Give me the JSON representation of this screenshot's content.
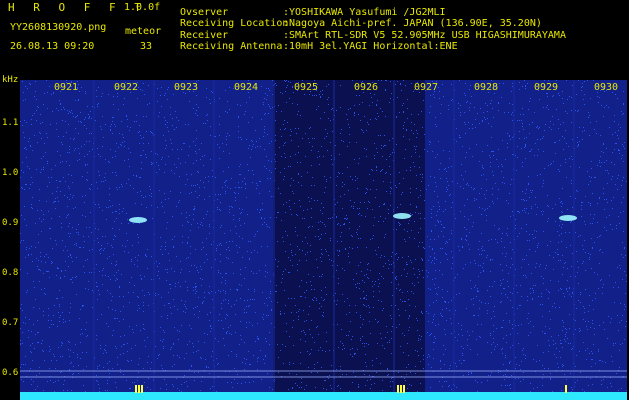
{
  "header": {
    "app_title": "H R O F F T",
    "version": "1.0.0f",
    "filename": "YY2608130920.png",
    "meteor_label": "meteor",
    "datetime": "26.08.13 09:20",
    "meteor_count": "33"
  },
  "station": [
    {
      "key": "Ovserver",
      "value": ":YOSHIKAWA Yasufumi /JG2MLI"
    },
    {
      "key": "Receiving Location",
      "value": ":Nagoya Aichi-pref. JAPAN (136.90E, 35.20N)"
    },
    {
      "key": "Receiver",
      "value": ":SMArt RTL-SDR V5 52.905MHz USB HIGASHIMURAYAMA"
    },
    {
      "key": "Receiving Antenna",
      "value": ":10mH 3el.YAGI Horizontal:ENE"
    }
  ],
  "spectrogram": {
    "y_unit": "kHz",
    "y_ticks": [
      "1.1",
      "1.0",
      "0.9",
      "0.8",
      "0.7",
      "0.6"
    ],
    "time_labels": [
      "0921",
      "0922",
      "0923",
      "0924",
      "0925",
      "0926",
      "0927",
      "0928",
      "0929",
      "0930"
    ],
    "colors": {
      "background": "#12208a",
      "dark_band": "#0a1050",
      "noise": "#2f5cff",
      "echo": "#9cf7ff",
      "text": "#e8e800",
      "bottom_band": "#2ee8ff"
    }
  }
}
